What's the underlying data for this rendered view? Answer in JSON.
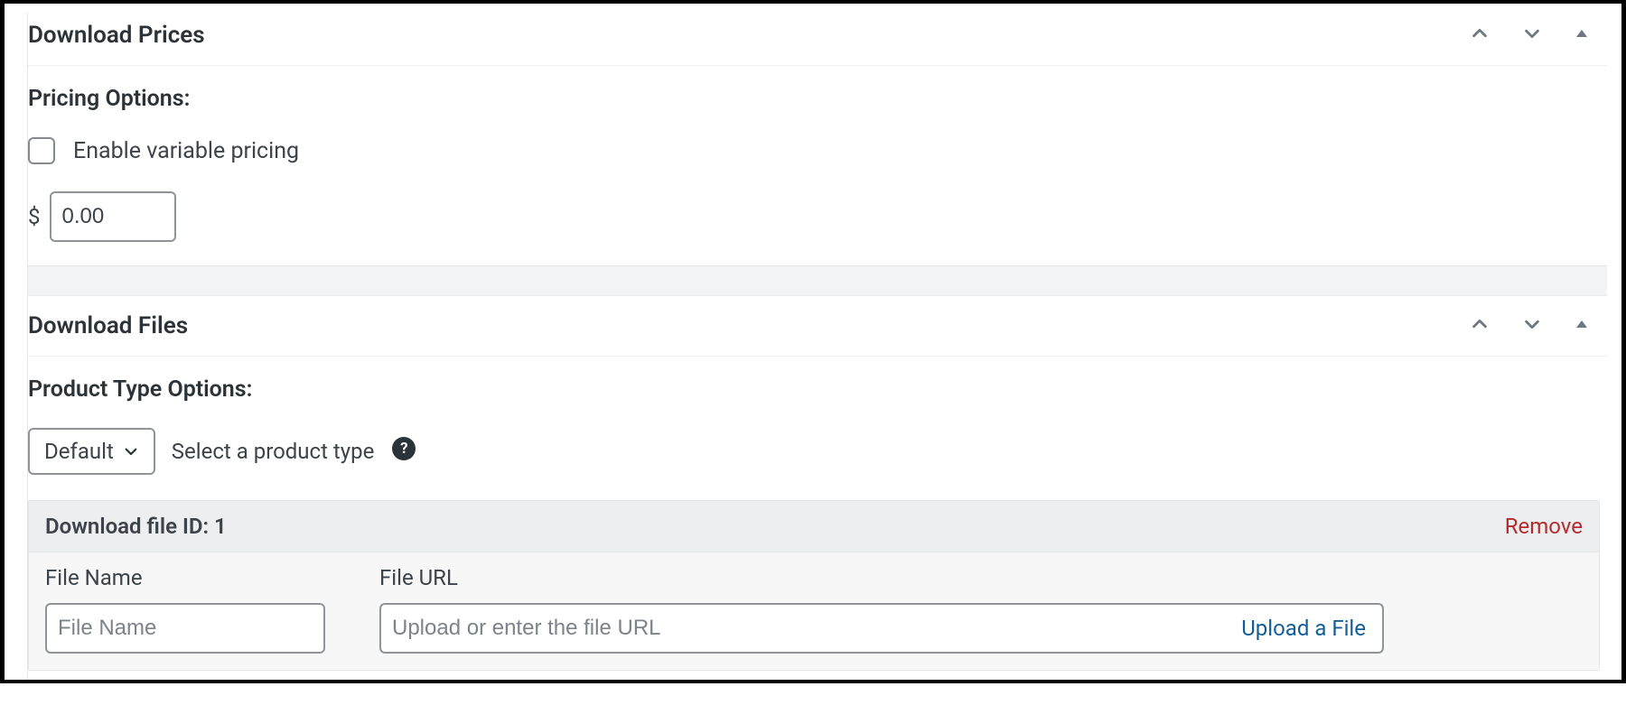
{
  "prices_panel": {
    "title": "Download Prices",
    "section_label": "Pricing Options:",
    "variable_pricing_label": "Enable variable pricing",
    "variable_pricing_checked": false,
    "currency_symbol": "$",
    "price_value": "0.00"
  },
  "files_panel": {
    "title": "Download Files",
    "section_label": "Product Type Options:",
    "product_type_selected": "Default",
    "product_type_hint": "Select a product type",
    "file": {
      "header": "Download file ID: 1",
      "remove_label": "Remove",
      "file_name_label": "File Name",
      "file_name_placeholder": "File Name",
      "file_name_value": "",
      "file_url_label": "File URL",
      "file_url_placeholder": "Upload or enter the file URL",
      "file_url_value": "",
      "upload_label": "Upload a File"
    }
  },
  "icons": {
    "help_glyph": "?"
  }
}
